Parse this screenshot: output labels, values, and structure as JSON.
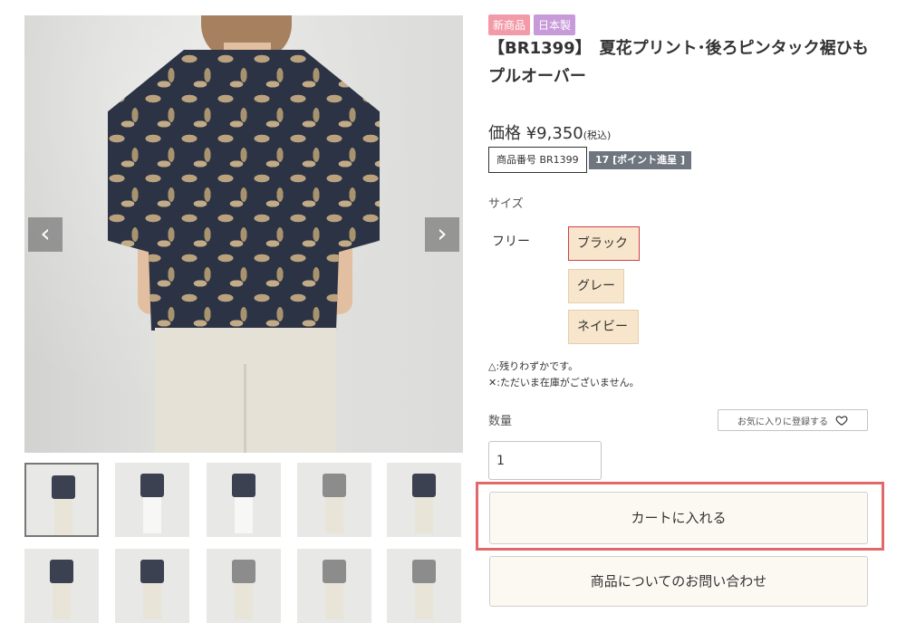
{
  "gallery": {
    "prev_icon": "chevron-left-icon",
    "next_icon": "chevron-right-icon",
    "prev_glyph": "‹",
    "next_glyph": "›",
    "thumbnail_count": 10
  },
  "product": {
    "badges": {
      "new": "新商品",
      "made_in": "日本製"
    },
    "title": "【BR1399】　夏花プリント･後ろピンタック裾ひもプルオーバー",
    "price_prefix": "価格",
    "price": "¥9,350",
    "tax_note": "(税込)",
    "sku": "商品番号 BR1399",
    "points": "17 [ポイント進呈 ]"
  },
  "size": {
    "label": "サイズ",
    "name": "フリー",
    "options": [
      "ブラック",
      "グレー",
      "ネイビー"
    ],
    "selected": "ブラック"
  },
  "stock_notes": [
    "△:残りわずかです。",
    "✕:ただいま在庫がございません。"
  ],
  "quantity": {
    "label": "数量",
    "value": "1"
  },
  "favorite": {
    "label": "お気に入りに登録する",
    "icon": "heart-icon"
  },
  "actions": {
    "cart": "カートに入れる",
    "inquiry": "商品についてのお問い合わせ"
  },
  "colors": {
    "selected_border": "#d33c4a",
    "highlight": "#e2696b",
    "option_bg": "#f8e6cc",
    "badge_new": "#f29aa8",
    "badge_jp": "#c79ad9"
  }
}
